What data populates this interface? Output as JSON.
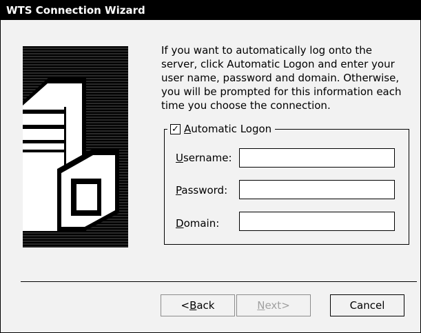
{
  "window": {
    "title": "WTS Connection Wizard"
  },
  "description": [
    "If you want to automatically log onto the",
    "server, click Automatic Logon and enter your",
    "user name, password and domain. Otherwise,",
    "you will be prompted for this information each",
    "time you choose the connection."
  ],
  "auto_logon": {
    "accel": "A",
    "rest": "utomatic Logon",
    "checked": true
  },
  "fields": {
    "username": {
      "accel": "U",
      "rest": "sername:",
      "value": ""
    },
    "password": {
      "accel": "P",
      "rest": "assword:",
      "value": ""
    },
    "domain": {
      "accel": "D",
      "rest": "omain:",
      "value": ""
    }
  },
  "buttons": {
    "back": {
      "pre": "<",
      "accel": "B",
      "rest": "ack"
    },
    "next": {
      "accel": "N",
      "rest": "ext>",
      "enabled": false
    },
    "cancel": {
      "label": "Cancel"
    }
  },
  "icons": {
    "wizard_art": "server-computer-icon",
    "checkmark": "checkmark-icon"
  }
}
